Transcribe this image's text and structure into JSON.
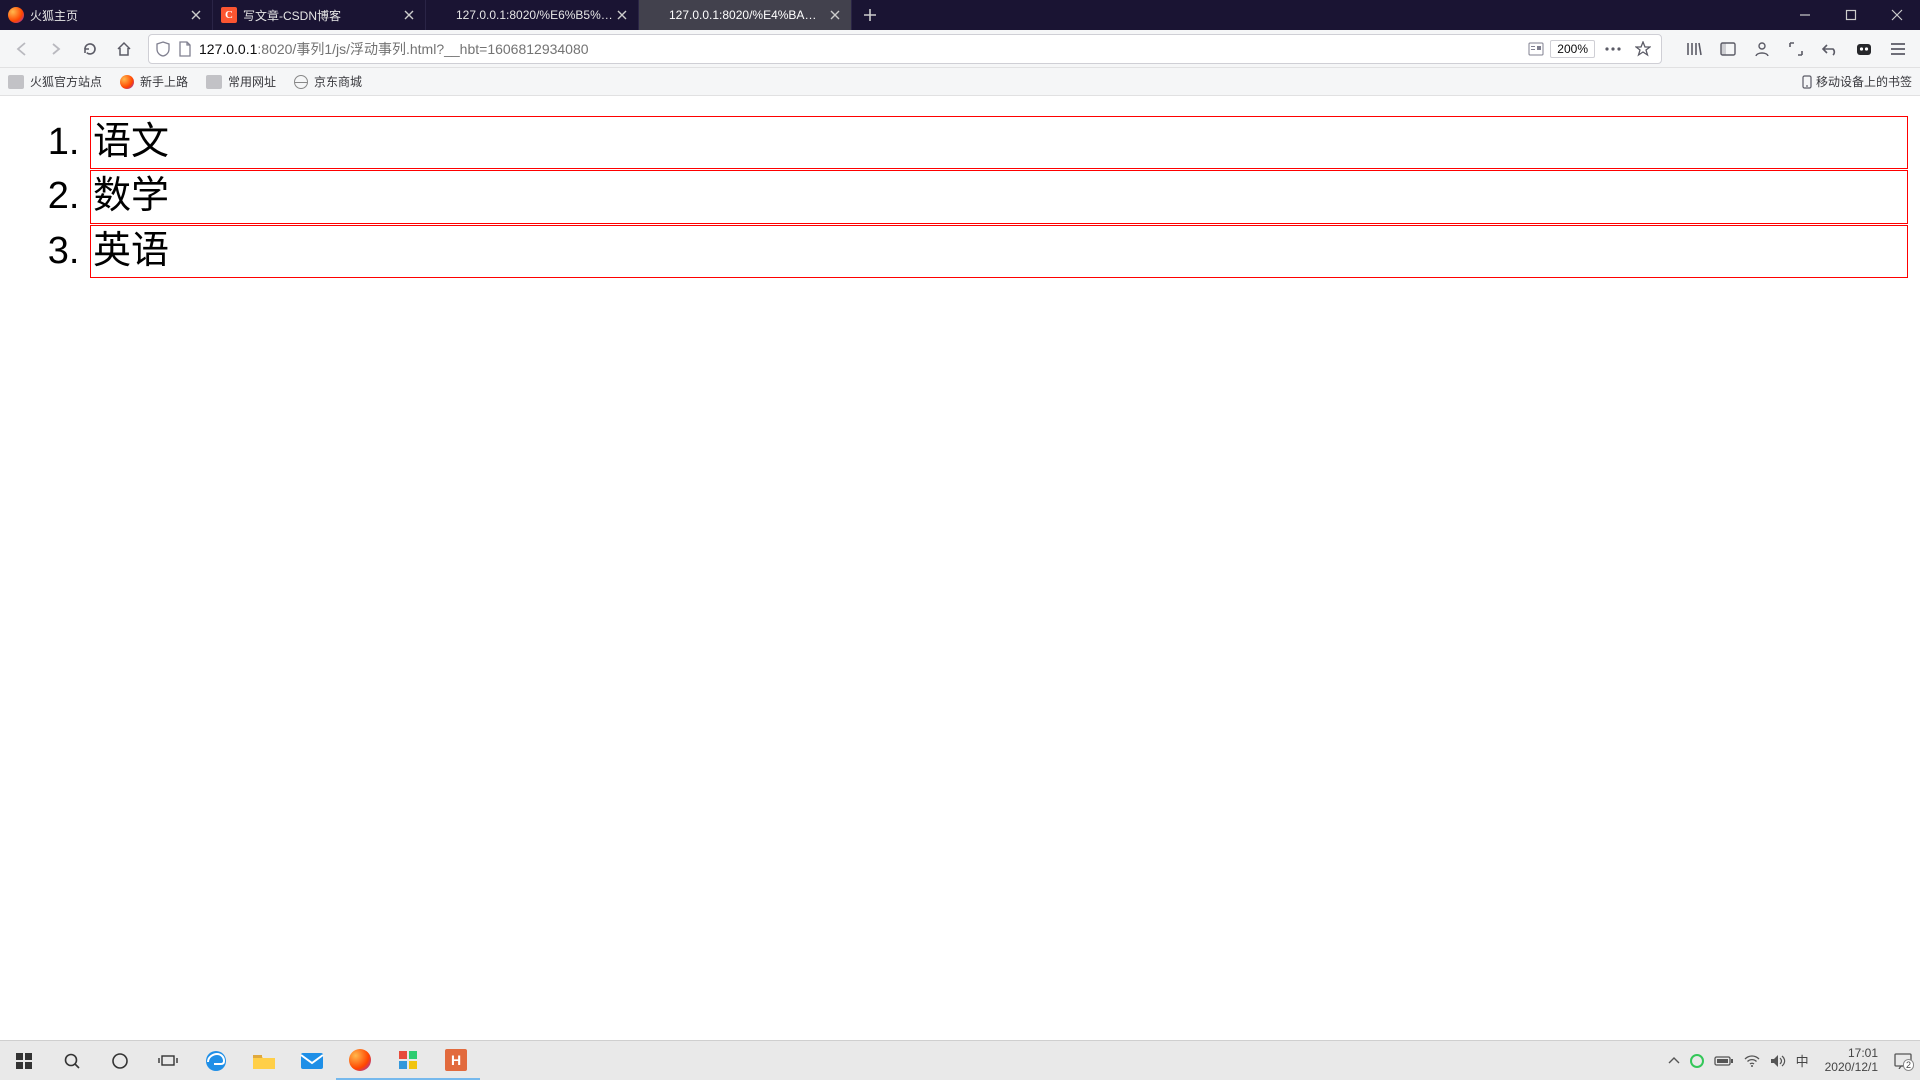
{
  "tabs": [
    {
      "label": "火狐主页",
      "favicon": "ff-logo",
      "active": false,
      "hasClose": true
    },
    {
      "label": "写文章-CSDN博客",
      "favicon": "csdn",
      "faviconText": "C",
      "active": false,
      "hasClose": true
    },
    {
      "label": "127.0.0.1:8020/%E6%B5%AE%E5",
      "favicon": "blank",
      "active": false,
      "hasClose": true
    },
    {
      "label": "127.0.0.1:8020/%E4%BA%8B%E5",
      "favicon": "blank",
      "active": true,
      "hasClose": true
    }
  ],
  "url": {
    "host": "127.0.0.1",
    "port_path": ":8020/事列1/js/浮动事列.html?__hbt=1606812934080"
  },
  "zoom": "200%",
  "bookmarks": {
    "items": [
      {
        "label": "火狐官方站点",
        "icon": "folder"
      },
      {
        "label": "新手上路",
        "icon": "ff"
      },
      {
        "label": "常用网址",
        "icon": "folder"
      },
      {
        "label": "京东商城",
        "icon": "globe"
      }
    ],
    "mobile": "移动设备上的书签"
  },
  "page": {
    "list_items": [
      "语文",
      "数学",
      "英语"
    ]
  },
  "tray": {
    "ime": "中",
    "time": "17:01",
    "date": "2020/12/1",
    "notif_count": "2"
  }
}
